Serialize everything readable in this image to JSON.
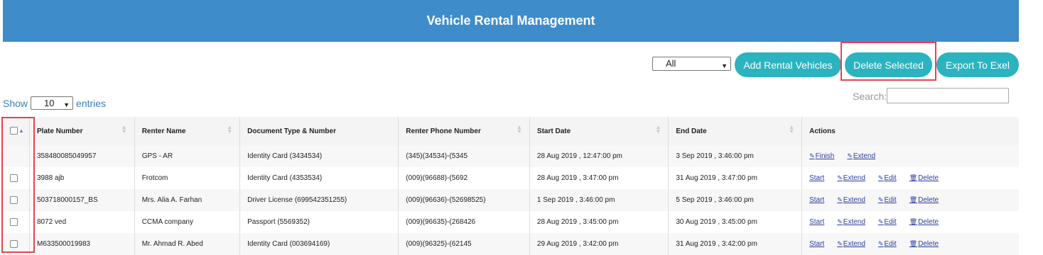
{
  "header": {
    "title": "Vehicle Rental Management"
  },
  "toolbar": {
    "filter_value": "All",
    "add_label": "Add Rental Vehicles",
    "delete_label": "Delete Selected",
    "export_label": "Export To Exel"
  },
  "length": {
    "show": "Show",
    "value": "10",
    "entries": "entries"
  },
  "search": {
    "label": "Search:"
  },
  "table": {
    "columns": [
      "Plate Number",
      "Renter Name",
      "Document Type & Number",
      "Renter Phone Number",
      "Start Date",
      "End Date",
      "Actions"
    ],
    "rows": [
      {
        "plate": "358480085049957",
        "renter": "GPS - AR",
        "doc": "Identity Card (3434534)",
        "phone": "(345)(34534)-(5345",
        "start": "28 Aug 2019 , 12:47:00 pm",
        "end": "3 Sep 2019 , 3:46:00 pm",
        "has_checkbox": false,
        "actions": [
          "Finish",
          "Extend"
        ]
      },
      {
        "plate": "3988 ajb",
        "renter": "Frotcom",
        "doc": "Identity Card (4353534)",
        "phone": "(009)(96688)-(5692",
        "start": "28 Aug 2019 , 3:47:00 pm",
        "end": "31 Aug 2019 , 3:47:00 pm",
        "has_checkbox": true,
        "actions": [
          "Start",
          "Extend",
          "Edit",
          "Delete"
        ]
      },
      {
        "plate": "503718000157_BS",
        "renter": "Mrs. Alia A. Farhan",
        "doc": "Driver License (699542351255)",
        "phone": "(009)(96636)-(52698525)",
        "start": "1 Sep 2019 , 3:46:00 pm",
        "end": "5 Sep 2019 , 3:46:00 pm",
        "has_checkbox": true,
        "actions": [
          "Start",
          "Extend",
          "Edit",
          "Delete"
        ]
      },
      {
        "plate": "8072 ved",
        "renter": "CCMA company",
        "doc": "Passport (5569352)",
        "phone": "(009)(96635)-(268426",
        "start": "28 Aug 2019 , 3:45:00 pm",
        "end": "30 Aug 2019 , 3:45:00 pm",
        "has_checkbox": true,
        "actions": [
          "Start",
          "Extend",
          "Edit",
          "Delete"
        ]
      },
      {
        "plate": "M633500019983",
        "renter": "Mr. Ahmad R. Abed",
        "doc": "Identity Card (003694169)",
        "phone": "(009)(96325)-(62145",
        "start": "29 Aug 2019 , 3:42:00 pm",
        "end": "31 Aug 2019 , 3:42:00 pm",
        "has_checkbox": true,
        "actions": [
          "Start",
          "Extend",
          "Edit",
          "Delete"
        ]
      }
    ]
  },
  "colors": {
    "header_bg": "#3f8ccb",
    "button_bg": "#2bb3c0",
    "highlight": "#e0474a",
    "link": "#2c3e9e"
  }
}
